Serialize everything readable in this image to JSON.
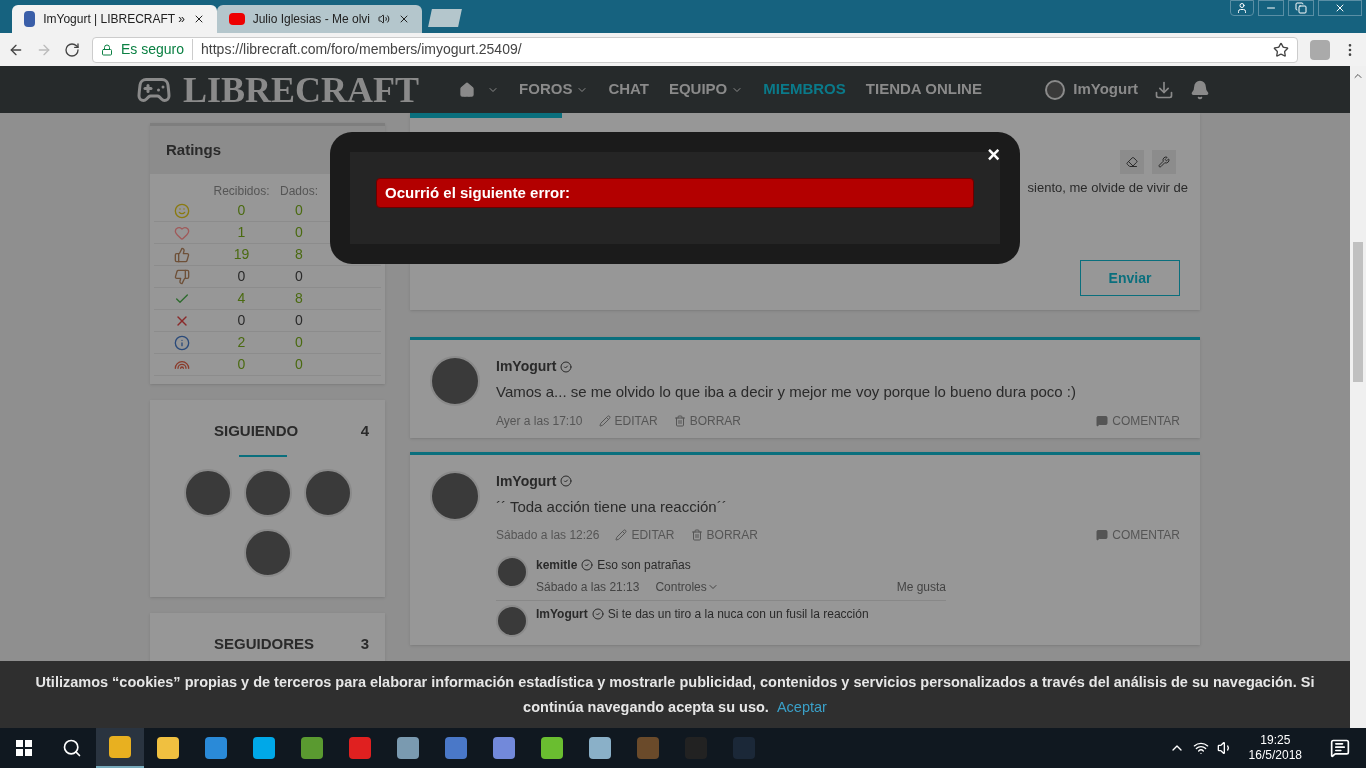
{
  "browser": {
    "tabs": [
      {
        "title": "ImYogurt | LIBRECRAFT »",
        "kind": "site",
        "selected": true,
        "audio": false
      },
      {
        "title": "Julio Iglesias - Me olvi",
        "kind": "video",
        "selected": false,
        "audio": true
      }
    ],
    "security": "Es seguro",
    "url": "https://librecraft.com/foro/members/imyogurt.25409/"
  },
  "nav": {
    "logo": "LIBRECRAFT",
    "items": [
      {
        "label": "FOROS",
        "dropdown": true,
        "selected": false
      },
      {
        "label": "CHAT",
        "dropdown": false,
        "selected": false
      },
      {
        "label": "EQUIPO",
        "dropdown": true,
        "selected": false
      },
      {
        "label": "MIEMBROS",
        "dropdown": false,
        "selected": true
      },
      {
        "label": "TIENDA ONLINE",
        "dropdown": false,
        "selected": false
      }
    ],
    "user": "ImYogurt"
  },
  "ratings": {
    "title": "Ratings",
    "columns": [
      "Recibidos:",
      "Dados:"
    ],
    "rows": [
      {
        "kind": "smile",
        "received": "0",
        "given": "0",
        "highlighted": true
      },
      {
        "kind": "heart",
        "received": "1",
        "given": "0",
        "highlighted": true
      },
      {
        "kind": "thumbs-up",
        "received": "19",
        "given": "8",
        "highlighted": true
      },
      {
        "kind": "thumbs-down",
        "received": "0",
        "given": "0",
        "highlighted": false
      },
      {
        "kind": "check",
        "received": "4",
        "given": "8",
        "highlighted": true
      },
      {
        "kind": "cross",
        "received": "0",
        "given": "0",
        "highlighted": false
      },
      {
        "kind": "info",
        "received": "2",
        "given": "0",
        "highlighted": true
      },
      {
        "kind": "rainbow",
        "received": "0",
        "given": "0",
        "highlighted": true
      }
    ]
  },
  "following": {
    "title": "SIGUIENDO",
    "count": "4"
  },
  "followers": {
    "title": "SEGUIDORES",
    "count": "3"
  },
  "editor": {
    "text": "siento, me olvide de vivir de",
    "submit": "Enviar"
  },
  "posts": [
    {
      "author": "ImYogurt",
      "text": "Vamos a... se me olvido lo que iba a decir y mejor me voy porque lo bueno dura poco :)",
      "time": "Ayer a las 17:10",
      "edit": "EDITAR",
      "delete": "BORRAR",
      "comment": "COMENTAR"
    },
    {
      "author": "ImYogurt",
      "text": "´´ Toda acción tiene una reacción´´",
      "time": "Sábado a las 12:26",
      "edit": "EDITAR",
      "delete": "BORRAR",
      "comment": "COMENTAR",
      "comments": [
        {
          "author": "kemitle",
          "text": "Eso son patrañas",
          "time": "Sábado a las 21:13",
          "controls": "Controles",
          "like": "Me gusta"
        },
        {
          "author": "ImYogurt",
          "text": "Si te das un tiro a la nuca con un fusil la reacción"
        }
      ]
    }
  ],
  "modal": {
    "error": "Ocurrió el siguiente error:",
    "close": "×"
  },
  "cookie": {
    "text": "Utilizamos “cookies” propias y de terceros para elaborar información estadística y mostrarle publicidad, contenidos y servicios personalizados a través del análisis de su navegación. Si continúa navegando acepta su uso.",
    "link": "Aceptar"
  },
  "taskbar": {
    "time": "19:25",
    "date": "16/5/2018"
  }
}
